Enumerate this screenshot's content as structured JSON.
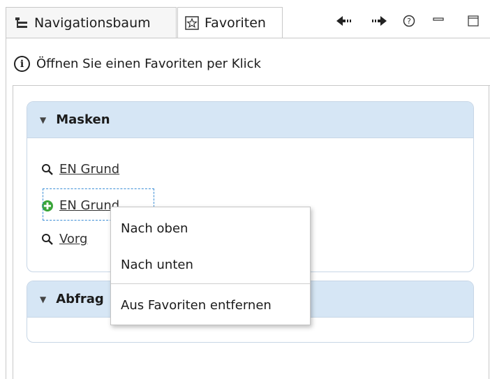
{
  "tabs": {
    "navigation_label": "Navigationsbaum",
    "favorites_label": "Favoriten"
  },
  "toolbar": {
    "back_icon": "arrow-left-icon",
    "forward_icon": "arrow-right-icon",
    "help_icon": "help-icon",
    "minimize_icon": "minimize-icon",
    "maximize_icon": "maximize-icon"
  },
  "info": {
    "text": "Öffnen Sie einen Favoriten per Klick"
  },
  "sections": [
    {
      "title": "Masken",
      "items": [
        {
          "label": "EN Grund",
          "icon": "search-icon"
        },
        {
          "label": "EN Grund",
          "icon": "add-circle-icon"
        },
        {
          "label": "Vorg",
          "icon": "search-icon"
        }
      ]
    },
    {
      "title": "Abfrag",
      "items": []
    }
  ],
  "context_menu": {
    "items": [
      "Nach oben",
      "Nach unten",
      "Aus Favoriten entfernen"
    ]
  },
  "colors": {
    "section_header": "#d6e6f5",
    "focus_border": "#3c8ed6",
    "add_icon": "#3aa53a"
  }
}
